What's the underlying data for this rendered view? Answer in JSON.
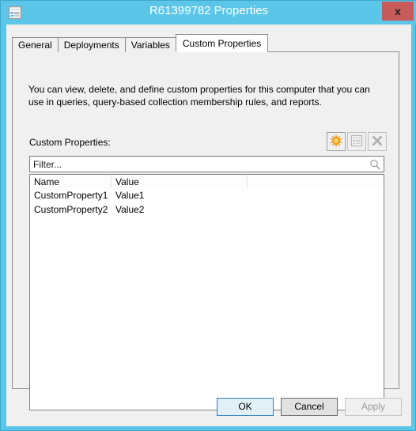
{
  "window": {
    "title": "R61399782 Properties",
    "icon": "properties-document-icon",
    "close_label": "x",
    "titlebar_color": "#5cc6e8",
    "close_button_color": "#c75b5b"
  },
  "tabs": [
    {
      "label": "General",
      "active": false
    },
    {
      "label": "Deployments",
      "active": false
    },
    {
      "label": "Variables",
      "active": false
    },
    {
      "label": "Custom Properties",
      "active": true
    }
  ],
  "panel": {
    "description": "You can view, delete, and define custom properties for this computer that you can use in queries, query-based collection membership rules, and reports.",
    "properties_label": "Custom Properties:"
  },
  "toolbar": {
    "buttons": [
      {
        "name": "new-property-button",
        "icon": "starburst-new-icon",
        "enabled": true
      },
      {
        "name": "edit-property-button",
        "icon": "properties-document-icon",
        "enabled": false
      },
      {
        "name": "delete-property-button",
        "icon": "x-delete-icon",
        "enabled": false
      }
    ]
  },
  "filter": {
    "value": "",
    "placeholder": "Filter...",
    "icon": "search-icon"
  },
  "list": {
    "columns": [
      "Name",
      "Value"
    ],
    "rows": [
      {
        "name": "CustomProperty1",
        "value": "Value1"
      },
      {
        "name": "CustomProperty2",
        "value": "Value2"
      }
    ]
  },
  "buttons": {
    "ok": "OK",
    "cancel": "Cancel",
    "apply": "Apply"
  }
}
